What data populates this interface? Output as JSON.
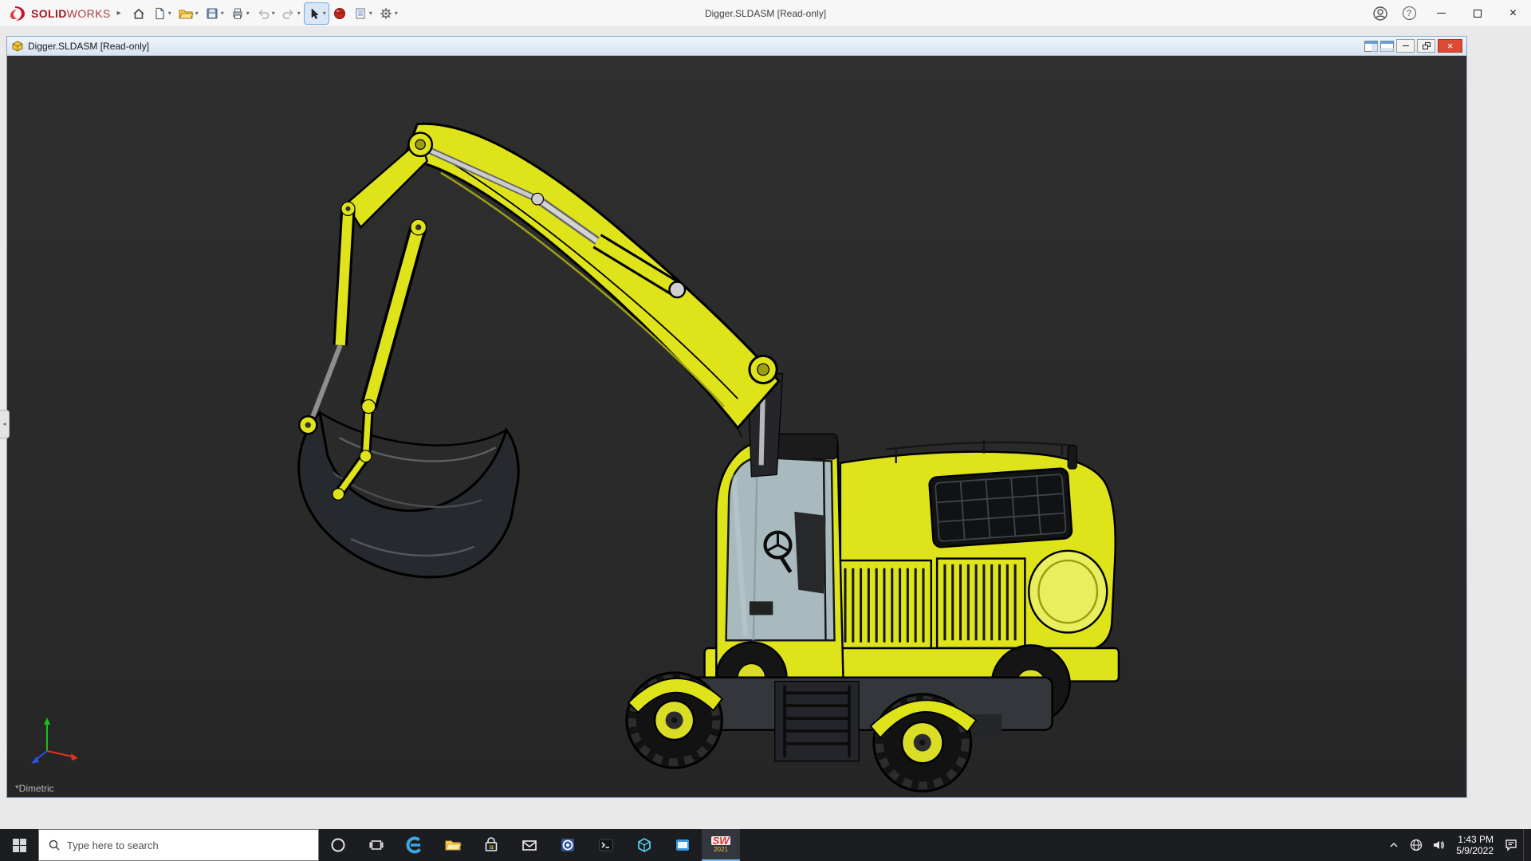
{
  "titlebar": {
    "brand_solid": "SOLID",
    "brand_works": "WORKS",
    "title": "Digger.SLDASM [Read-only]"
  },
  "doc_window": {
    "title": "Digger.SLDASM [Read-only]"
  },
  "viewport": {
    "orientation": "*Dimetric"
  },
  "taskbar": {
    "search_placeholder": "Type here to search",
    "sw_label": "SW",
    "sw_year": "2021",
    "time": "1:43 PM",
    "date": "5/9/2022"
  },
  "glyphs": {
    "flyout": "▸",
    "caret": "▾",
    "panel_tab": "◄",
    "close": "×",
    "help": "?"
  },
  "colors": {
    "machine_yellow": "#dfe319",
    "viewport_bg": "#2b2b2b",
    "taskbar_bg": "#1b1d21",
    "close_red": "#dd4a34"
  }
}
